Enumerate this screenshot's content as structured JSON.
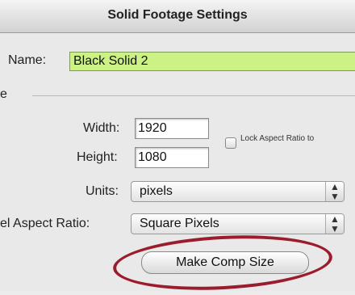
{
  "window": {
    "title": "Solid Footage Settings"
  },
  "name_field": {
    "label": "Name:",
    "value": "Black Solid 2"
  },
  "size_group": {
    "label_fragment": "e"
  },
  "width": {
    "label": "Width:",
    "value": "1920"
  },
  "height": {
    "label": "Height:",
    "value": "1080"
  },
  "lock_aspect": {
    "label": "Lock Aspect Ratio to"
  },
  "units": {
    "label": "Units:",
    "value": "pixels"
  },
  "pixel_aspect": {
    "label": "el Aspect Ratio:",
    "value": "Square Pixels"
  },
  "make_comp_size_button": {
    "label": "Make Comp Size"
  },
  "colors": {
    "name_highlight": "#ccf285",
    "annotation": "#9b1c2c"
  }
}
